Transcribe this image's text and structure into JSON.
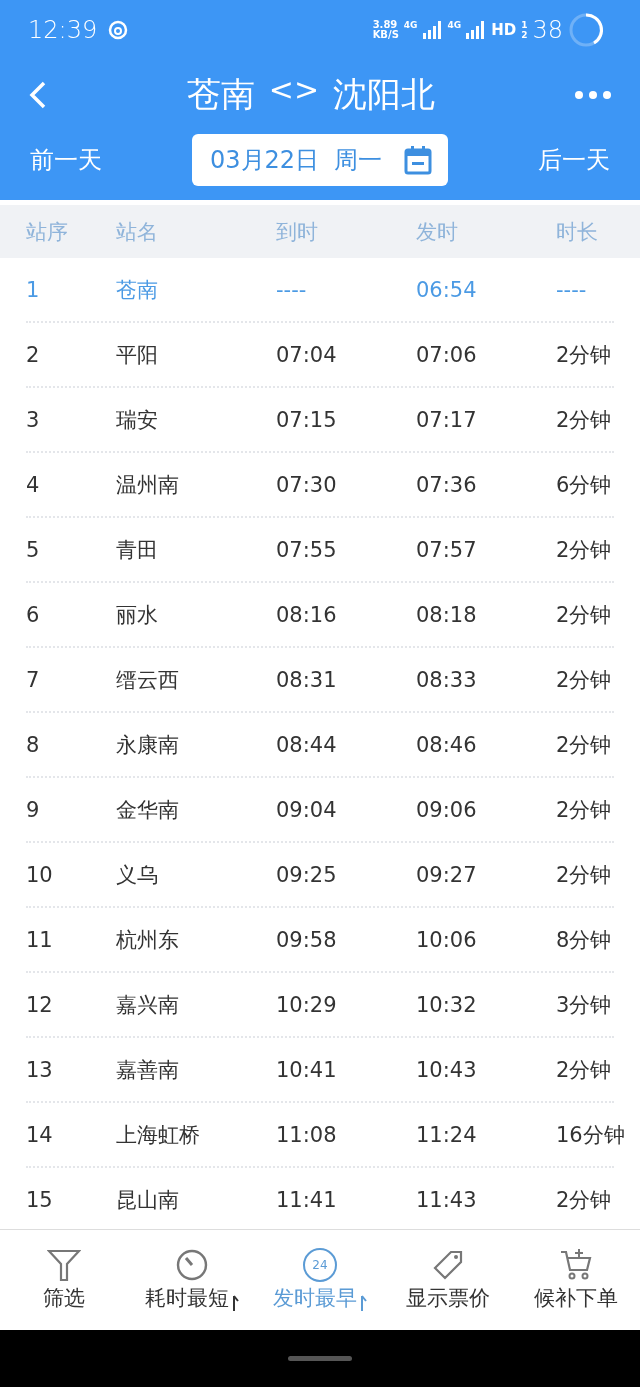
{
  "status_bar": {
    "time": "12:39",
    "speed": "3.89",
    "speed_unit": "KB/S",
    "network_1": "4G",
    "network_2": "4G",
    "hd": "HD",
    "sim_1": "1",
    "sim_2": "2",
    "battery": "38"
  },
  "header": {
    "from": "苍南",
    "separator": "<>",
    "to": "沈阳北"
  },
  "date_bar": {
    "prev": "前一天",
    "date": "03月22日  周一",
    "next": "后一天"
  },
  "table": {
    "columns": [
      "站序",
      "站名",
      "到时",
      "发时",
      "时长"
    ],
    "rows": [
      {
        "no": "1",
        "station": "苍南",
        "arrive": "----",
        "depart": "06:54",
        "stay": "----",
        "highlighted": true
      },
      {
        "no": "2",
        "station": "平阳",
        "arrive": "07:04",
        "depart": "07:06",
        "stay": "2分钟",
        "highlighted": false
      },
      {
        "no": "3",
        "station": "瑞安",
        "arrive": "07:15",
        "depart": "07:17",
        "stay": "2分钟",
        "highlighted": false
      },
      {
        "no": "4",
        "station": "温州南",
        "arrive": "07:30",
        "depart": "07:36",
        "stay": "6分钟",
        "highlighted": false
      },
      {
        "no": "5",
        "station": "青田",
        "arrive": "07:55",
        "depart": "07:57",
        "stay": "2分钟",
        "highlighted": false
      },
      {
        "no": "6",
        "station": "丽水",
        "arrive": "08:16",
        "depart": "08:18",
        "stay": "2分钟",
        "highlighted": false
      },
      {
        "no": "7",
        "station": "缙云西",
        "arrive": "08:31",
        "depart": "08:33",
        "stay": "2分钟",
        "highlighted": false
      },
      {
        "no": "8",
        "station": "永康南",
        "arrive": "08:44",
        "depart": "08:46",
        "stay": "2分钟",
        "highlighted": false
      },
      {
        "no": "9",
        "station": "金华南",
        "arrive": "09:04",
        "depart": "09:06",
        "stay": "2分钟",
        "highlighted": false
      },
      {
        "no": "10",
        "station": "义乌",
        "arrive": "09:25",
        "depart": "09:27",
        "stay": "2分钟",
        "highlighted": false
      },
      {
        "no": "11",
        "station": "杭州东",
        "arrive": "09:58",
        "depart": "10:06",
        "stay": "8分钟",
        "highlighted": false
      },
      {
        "no": "12",
        "station": "嘉兴南",
        "arrive": "10:29",
        "depart": "10:32",
        "stay": "3分钟",
        "highlighted": false
      },
      {
        "no": "13",
        "station": "嘉善南",
        "arrive": "10:41",
        "depart": "10:43",
        "stay": "2分钟",
        "highlighted": false
      },
      {
        "no": "14",
        "station": "上海虹桥",
        "arrive": "11:08",
        "depart": "11:24",
        "stay": "16分钟",
        "highlighted": false
      },
      {
        "no": "15",
        "station": "昆山南",
        "arrive": "11:41",
        "depart": "11:43",
        "stay": "2分钟",
        "highlighted": false
      }
    ]
  },
  "bottom_bar": [
    {
      "kind": "filter",
      "label": "筛选",
      "sortable": false,
      "selected": false
    },
    {
      "kind": "timer",
      "label": "耗时最短",
      "sortable": true,
      "selected": false
    },
    {
      "kind": "clock24",
      "icon_text": "24",
      "label": "发时最早",
      "sortable": true,
      "selected": true
    },
    {
      "kind": "tag",
      "label": "显示票价",
      "sortable": false,
      "selected": false
    },
    {
      "kind": "cart",
      "label": "候补下单",
      "sortable": false,
      "selected": false
    }
  ]
}
